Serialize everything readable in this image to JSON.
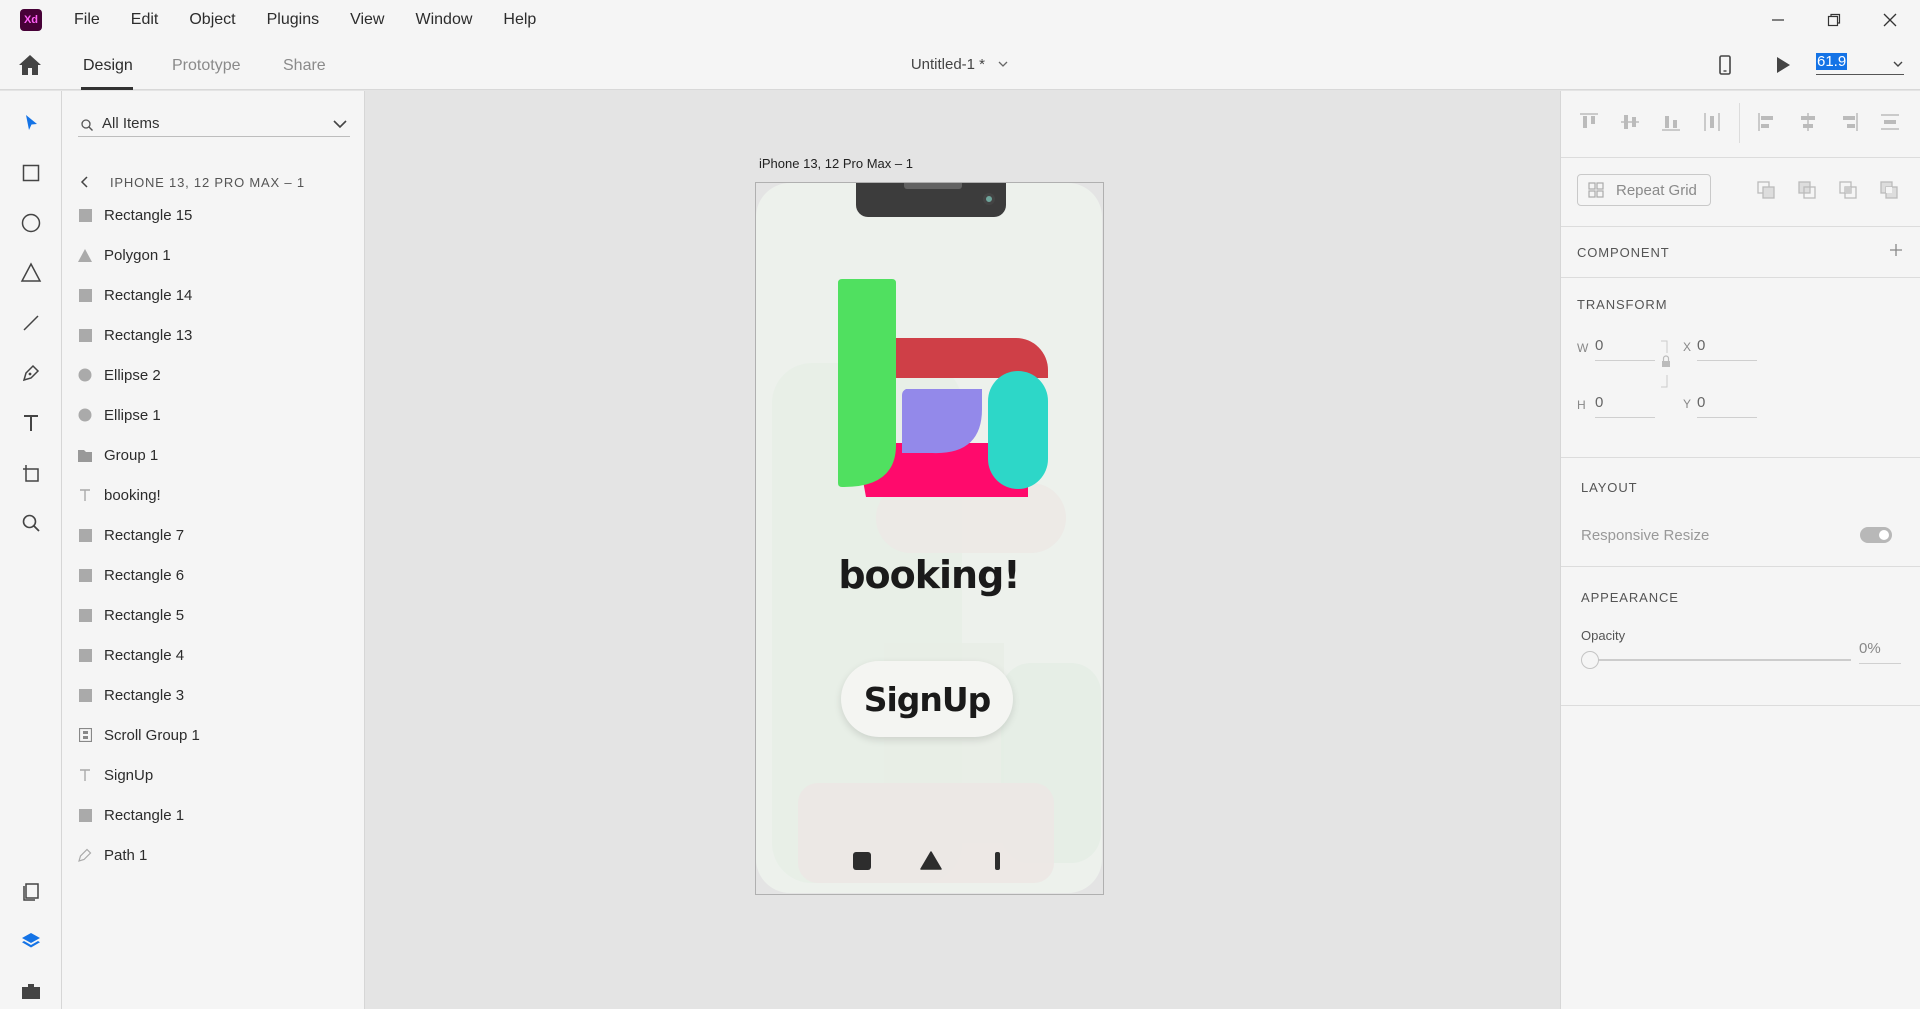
{
  "app": {
    "logo": "Xd"
  },
  "menu": [
    "File",
    "Edit",
    "Object",
    "Plugins",
    "View",
    "Window",
    "Help"
  ],
  "tabs": [
    "Design",
    "Prototype",
    "Share"
  ],
  "document": {
    "title": "Untitled-1 *"
  },
  "zoom": {
    "value": "61.9"
  },
  "layers_panel": {
    "search_label": "All Items",
    "breadcrumb": "IPHONE 13, 12 PRO MAX – 1",
    "items": [
      {
        "label": "Rectangle 15",
        "icon": "rectangle-icon"
      },
      {
        "label": "Polygon 1",
        "icon": "polygon-icon"
      },
      {
        "label": "Rectangle 14",
        "icon": "rectangle-icon"
      },
      {
        "label": "Rectangle 13",
        "icon": "rectangle-icon"
      },
      {
        "label": "Ellipse 2",
        "icon": "ellipse-icon"
      },
      {
        "label": "Ellipse 1",
        "icon": "ellipse-icon"
      },
      {
        "label": "Group 1",
        "icon": "folder-icon"
      },
      {
        "label": "booking!",
        "icon": "text-icon"
      },
      {
        "label": "Rectangle 7",
        "icon": "rectangle-icon"
      },
      {
        "label": "Rectangle 6",
        "icon": "rectangle-icon"
      },
      {
        "label": "Rectangle 5",
        "icon": "rectangle-icon"
      },
      {
        "label": "Rectangle 4",
        "icon": "rectangle-icon"
      },
      {
        "label": "Rectangle 3",
        "icon": "rectangle-icon"
      },
      {
        "label": "Scroll Group 1",
        "icon": "scroll-group-icon"
      },
      {
        "label": "SignUp",
        "icon": "text-icon"
      },
      {
        "label": "Rectangle 1",
        "icon": "rectangle-icon"
      },
      {
        "label": "Path 1",
        "icon": "pen-icon"
      }
    ]
  },
  "canvas": {
    "artboard_label": "iPhone 13, 12 Pro Max – 1",
    "phone_title": "booking!",
    "signup_label": "SignUp"
  },
  "property_panel": {
    "repeat_grid": "Repeat Grid",
    "component": "COMPONENT",
    "transform": "TRANSFORM",
    "w_label": "W",
    "w_value": "0",
    "x_label": "X",
    "x_value": "0",
    "h_label": "H",
    "h_value": "0",
    "y_label": "Y",
    "y_value": "0",
    "layout": "LAYOUT",
    "responsive_resize": "Responsive Resize",
    "appearance": "APPEARANCE",
    "opacity_label": "Opacity",
    "opacity_value": "0%"
  },
  "colors": {
    "accent_selection": "#1473e6",
    "logo_green": "#50e060",
    "logo_red": "#cf3f47",
    "logo_pink": "#ff0a6c",
    "logo_purple": "#9389ea",
    "logo_teal": "#2dd7c8"
  }
}
